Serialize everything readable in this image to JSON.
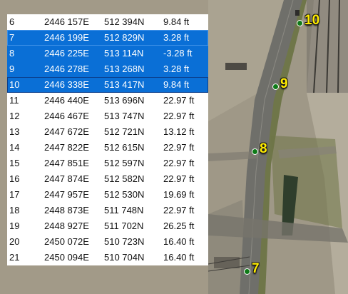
{
  "map": {
    "colors": {
      "terrain": "#a29a88",
      "road": "#6f6f6a",
      "vegetation": "#5f6b34",
      "water": "#2f3e2c",
      "marker": "#0f7a18",
      "marker_label": "#ffec00"
    },
    "markers": [
      {
        "label": "10"
      },
      {
        "label": "9"
      },
      {
        "label": "8"
      },
      {
        "label": "7"
      }
    ]
  },
  "table": {
    "selection_color": "#0a6fd6",
    "rows": [
      {
        "id": "6",
        "easting": "2446 157E",
        "northing": "512 394N",
        "elevation": "9.84 ft",
        "selected": false
      },
      {
        "id": "7",
        "easting": "2446 199E",
        "northing": "512 829N",
        "elevation": "3.28 ft",
        "selected": true
      },
      {
        "id": "8",
        "easting": "2446 225E",
        "northing": "513 114N",
        "elevation": "-3.28 ft",
        "selected": true
      },
      {
        "id": "9",
        "easting": "2446 278E",
        "northing": "513 268N",
        "elevation": "3.28 ft",
        "selected": true
      },
      {
        "id": "10",
        "easting": "2446 338E",
        "northing": "513 417N",
        "elevation": "9.84 ft",
        "selected": true
      },
      {
        "id": "11",
        "easting": "2446 440E",
        "northing": "513 696N",
        "elevation": "22.97 ft",
        "selected": false
      },
      {
        "id": "12",
        "easting": "2446 467E",
        "northing": "513 747N",
        "elevation": "22.97 ft",
        "selected": false
      },
      {
        "id": "13",
        "easting": "2447 672E",
        "northing": "512 721N",
        "elevation": "13.12 ft",
        "selected": false
      },
      {
        "id": "14",
        "easting": "2447 822E",
        "northing": "512 615N",
        "elevation": "22.97 ft",
        "selected": false
      },
      {
        "id": "15",
        "easting": "2447 851E",
        "northing": "512 597N",
        "elevation": "22.97 ft",
        "selected": false
      },
      {
        "id": "16",
        "easting": "2447 874E",
        "northing": "512 582N",
        "elevation": "22.97 ft",
        "selected": false
      },
      {
        "id": "17",
        "easting": "2447 957E",
        "northing": "512 530N",
        "elevation": "19.69 ft",
        "selected": false
      },
      {
        "id": "18",
        "easting": "2448 873E",
        "northing": "511 748N",
        "elevation": "22.97 ft",
        "selected": false
      },
      {
        "id": "19",
        "easting": "2448 927E",
        "northing": "511 702N",
        "elevation": "26.25 ft",
        "selected": false
      },
      {
        "id": "20",
        "easting": "2450 072E",
        "northing": "510 723N",
        "elevation": "16.40 ft",
        "selected": false
      },
      {
        "id": "21",
        "easting": "2450 094E",
        "northing": "510 704N",
        "elevation": "16.40 ft",
        "selected": false
      }
    ]
  }
}
